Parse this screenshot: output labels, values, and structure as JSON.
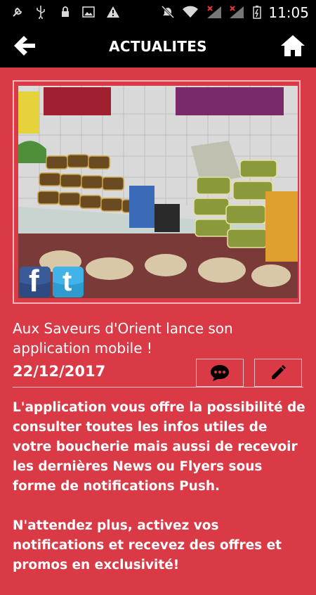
{
  "status_bar": {
    "time": "11:05",
    "icons": [
      "wrench-icon",
      "usb-icon",
      "lock-icon",
      "image-icon",
      "warning-icon",
      "mute-icon",
      "wifi-icon",
      "signal-off-icon",
      "signal-off-icon",
      "battery-icon"
    ]
  },
  "header": {
    "title": "ACTUALITES",
    "back_icon": "arrow-left-icon",
    "home_icon": "home-icon"
  },
  "article": {
    "title": "Aux Saveurs d'Orient lance son application mobile !",
    "date": "22/12/2017",
    "paragraphs": [
      "L'application vous offre la possibilité de consulter toutes les infos utiles de votre boucherie mais aussi de recevoir les dernières News ou Flyers sous forme de notifications Push.",
      "N'attendez plus, activez vos notifications et recevez des offres et promos en exclusivité!"
    ],
    "social": {
      "facebook_label": "f",
      "twitter_label": "t"
    }
  },
  "colors": {
    "background": "#d93a46",
    "header": "#000000",
    "text": "#ffffff"
  }
}
